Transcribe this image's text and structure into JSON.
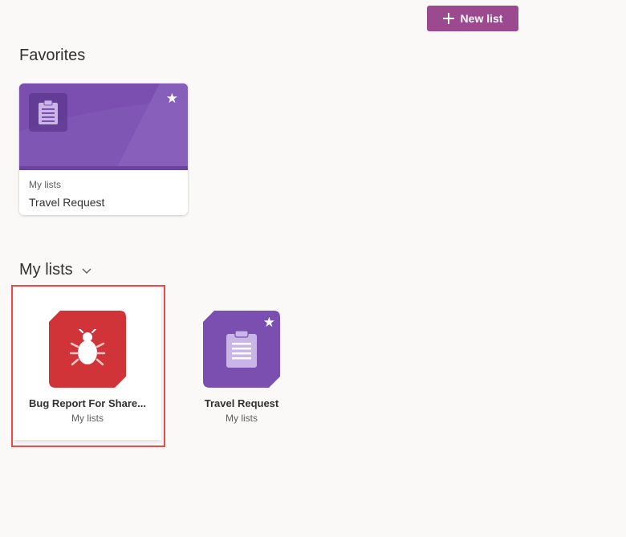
{
  "toolbar": {
    "new_list_label": "New list",
    "new_list_icon": "plus-icon"
  },
  "favorites": {
    "title": "Favorites",
    "cards": [
      {
        "caption": "My lists",
        "name": "Travel Request",
        "icon": "clipboard-list-icon",
        "favorited_icon": "star-icon",
        "color": "#7a4fb0"
      }
    ]
  },
  "my_lists": {
    "title": "My lists",
    "toggle_icon": "chevron-down-icon",
    "items": [
      {
        "name": "Bug Report For Share...",
        "subtitle": "My lists",
        "icon": "bug-icon",
        "color": "#d13438",
        "selected": true,
        "favorited": false
      },
      {
        "name": "Travel Request",
        "subtitle": "My lists",
        "icon": "clipboard-list-icon",
        "color": "#7a4fb0",
        "selected": false,
        "favorited": true
      }
    ]
  },
  "colors": {
    "accent": "#9c4a90",
    "selection_outline": "#e74c4c",
    "background": "#faf9f8"
  }
}
